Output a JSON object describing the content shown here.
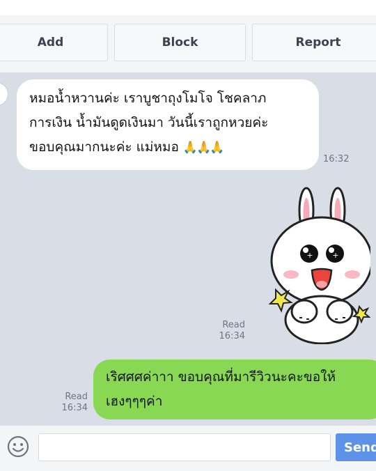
{
  "actions": {
    "add_label": "Add",
    "block_label": "Block",
    "report_label": "Report"
  },
  "messages": {
    "incoming": {
      "line1": "หมอน้ำหวานค่ะ เราบูชาถุงโมโจ โชคลาภ",
      "line2": "การเงิน น้ำมันดูดเงินมา วันนี้เราถูกหวยค่ะ",
      "line3": "ขอบคุณมากนะค่ะ แม่หมอ",
      "emoji": "🙏🙏🙏",
      "time": "16:32"
    },
    "sticker": {
      "read_label": "Read",
      "time": "16:34"
    },
    "outgoing": {
      "line1": "เริศศศค่าาา ขอบคุณที่มารีวิวนะคะขอให้",
      "line2": "เฮงๆๆๆค่า",
      "read_label": "Read",
      "time": "16:34"
    }
  },
  "composer": {
    "placeholder": "",
    "send_label": "Send"
  },
  "colors": {
    "chat_background": "#d8dde6",
    "outgoing_bubble": "#88d854",
    "send_button": "#5d92e8"
  }
}
